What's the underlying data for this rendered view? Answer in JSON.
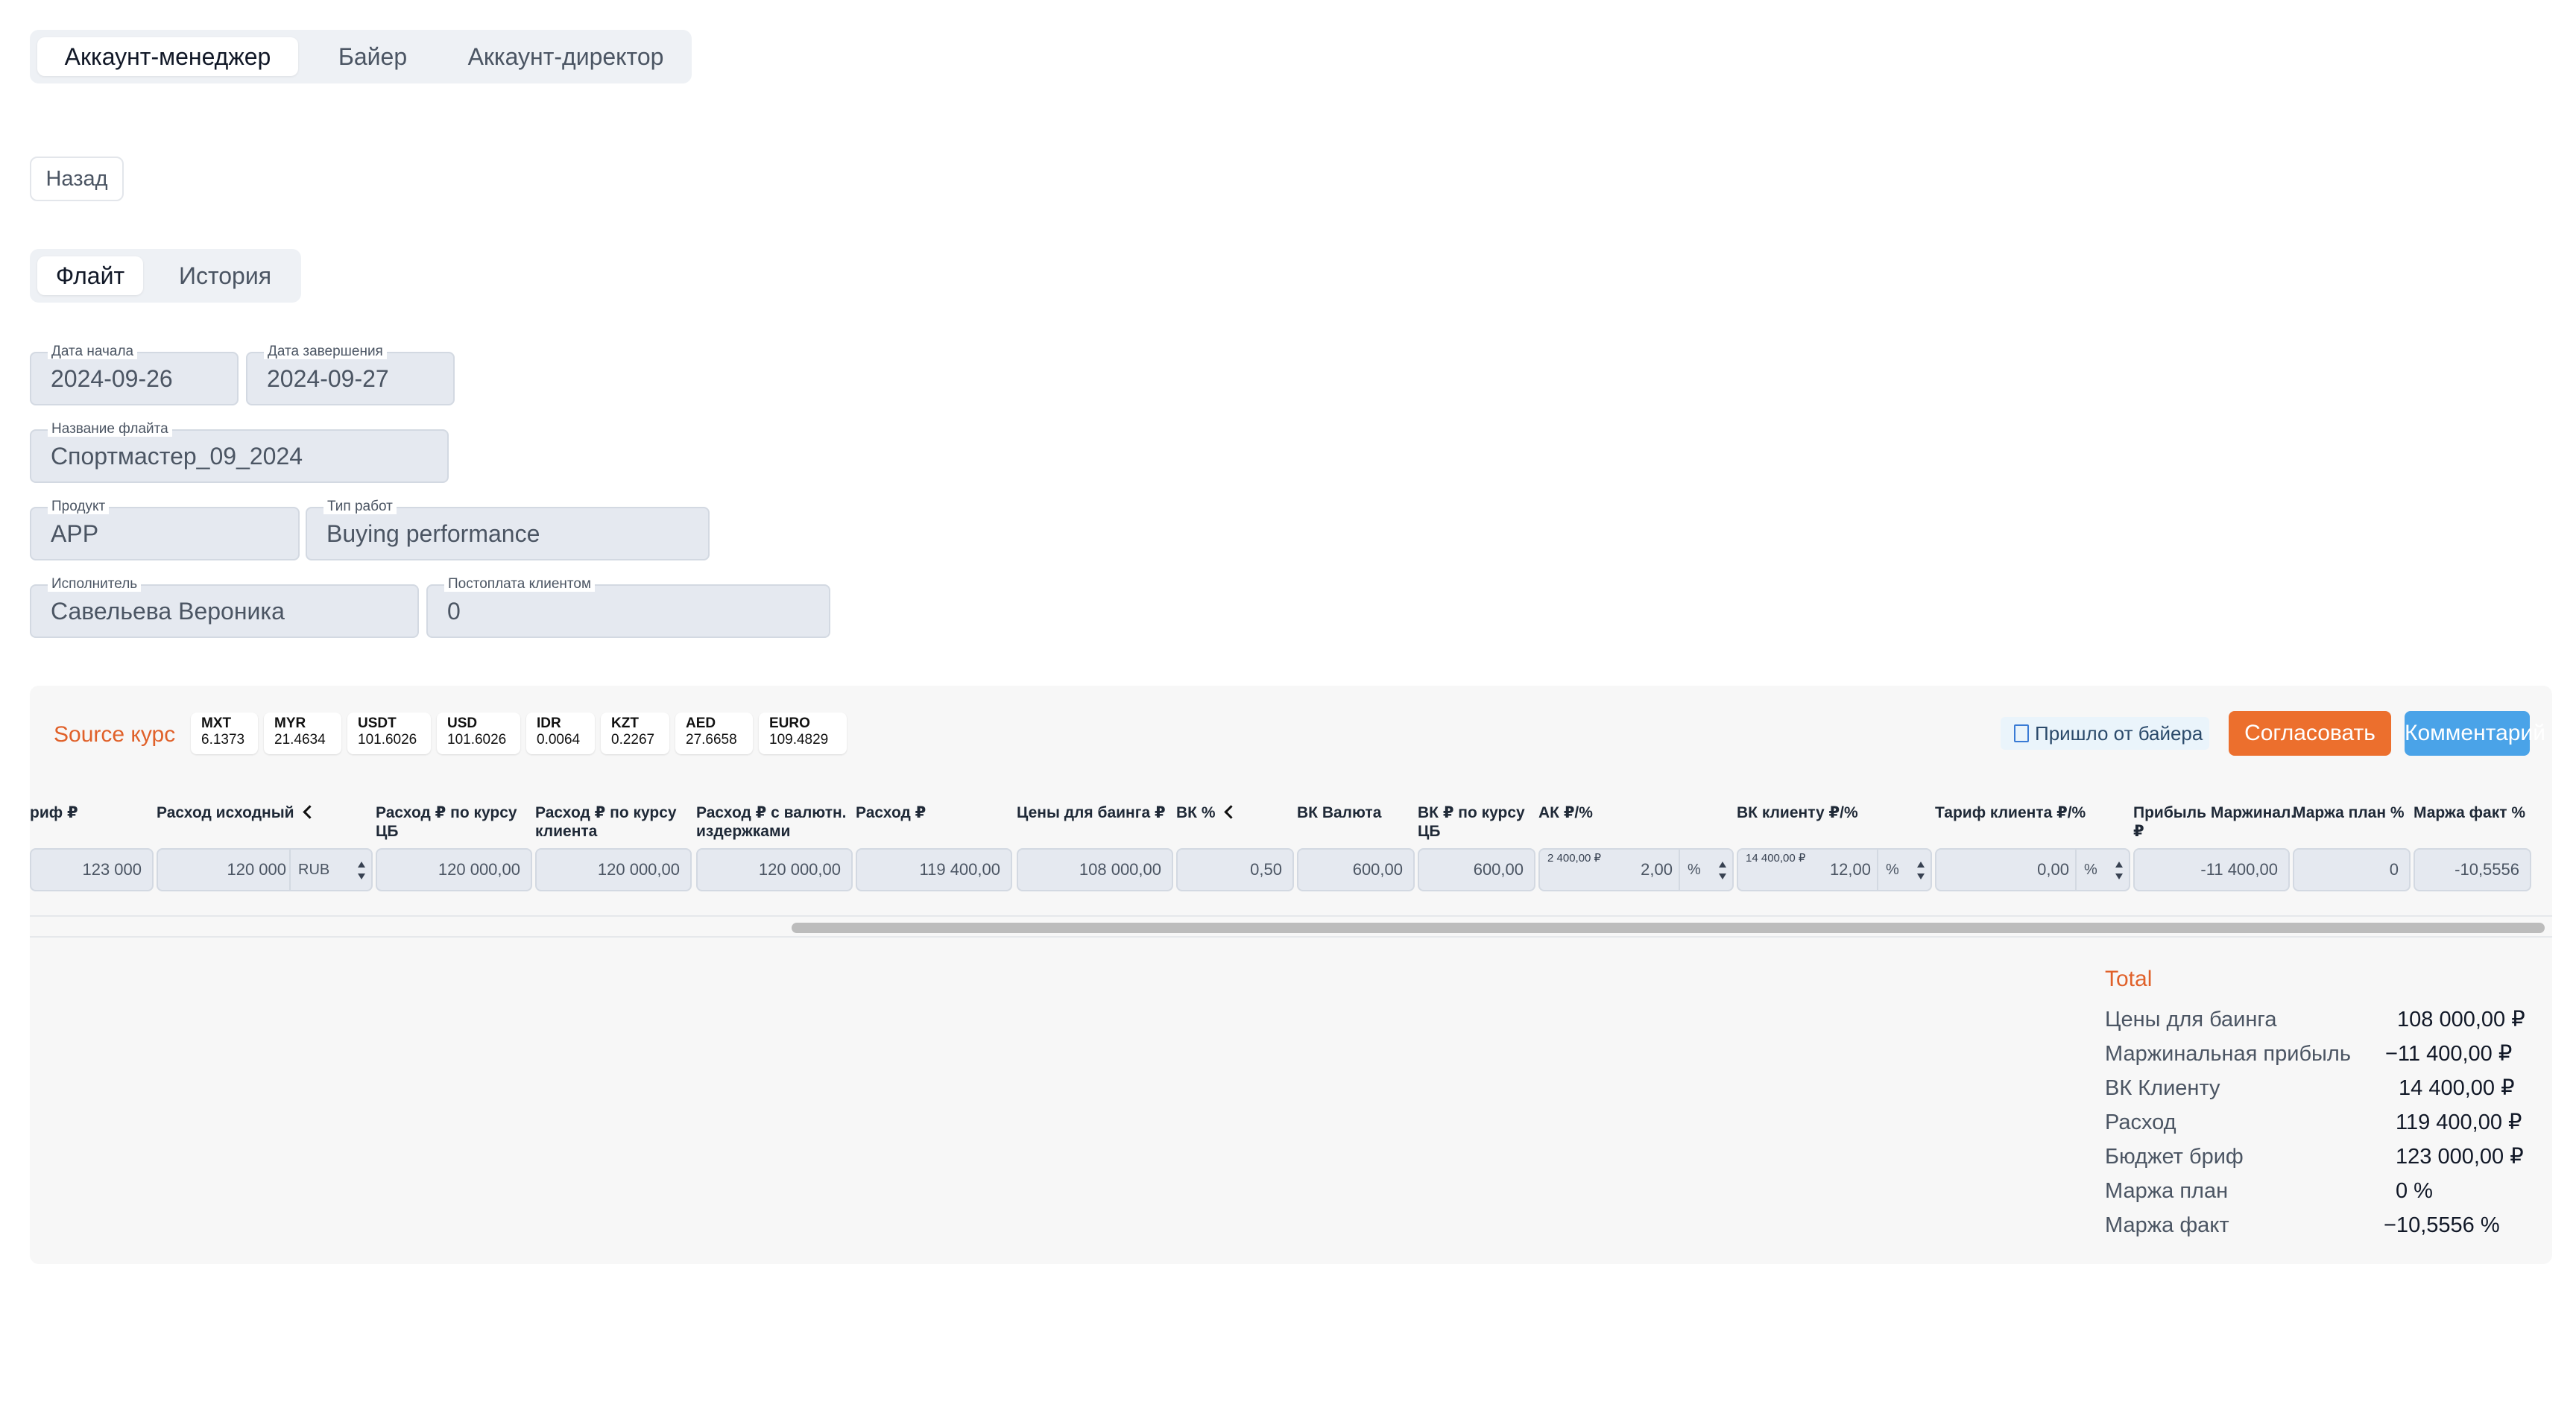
{
  "role_tabs": [
    "Аккаунт-менеджер",
    "Байер",
    "Аккаунт-директор"
  ],
  "back_label": "Назад",
  "flight_tabs": [
    "Флайт",
    "История"
  ],
  "fields": {
    "start_date": {
      "label": "Дата начала",
      "value": "2024-09-26"
    },
    "end_date": {
      "label": "Дата завершения",
      "value": "2024-09-27"
    },
    "flight_name": {
      "label": "Название флайта",
      "value": "Спортмастер_09_2024"
    },
    "product": {
      "label": "Продукт",
      "value": "APP"
    },
    "work_type": {
      "label": "Тип работ",
      "value": "Buying performance"
    },
    "executor": {
      "label": "Исполнитель",
      "value": "Савельева Вероника"
    },
    "postpay": {
      "label": "Постоплата клиентом",
      "value": "0"
    }
  },
  "source_rate_label": "Source курс",
  "rates": [
    {
      "name": "MXT",
      "value": "6.1373"
    },
    {
      "name": "MYR",
      "value": "21.4634"
    },
    {
      "name": "USDT",
      "value": "101.6026"
    },
    {
      "name": "USD",
      "value": "101.6026"
    },
    {
      "name": "IDR",
      "value": "0.0064"
    },
    {
      "name": "KZT",
      "value": "0.2267"
    },
    {
      "name": "AED",
      "value": "27.6658"
    },
    {
      "name": "EURO",
      "value": "109.4829"
    }
  ],
  "actions": {
    "from_buyer": "Пришло от байера",
    "approve": "Согласовать",
    "comment": "Комментарий"
  },
  "columns": {
    "tariff": "риф ₽",
    "spend_initial": "Расход исходный",
    "spend_cb_l1": "Расход ₽ по курсу",
    "spend_cb_l2": "ЦБ",
    "spend_client_l1": "Расход ₽ по курсу",
    "spend_client_l2": "клиента",
    "spend_fx_l1": "Расход ₽ с валютн.",
    "spend_fx_l2": "издержками",
    "spend": "Расход ₽",
    "buying_price": "Цены для баинга ₽",
    "vk_pct": "ВК %",
    "vk_currency": "ВК Валюта",
    "vk_cb_l1": "ВК ₽ по курсу",
    "vk_cb_l2": "ЦБ",
    "ak": "АК ₽/%",
    "vk_client": "ВК клиенту ₽/%",
    "client_tariff": "Тариф клиента ₽/%",
    "profit_l1": "Прибыль Маржинал.",
    "profit_l2": "₽",
    "margin_plan": "Маржа план %",
    "margin_fact": "Маржа факт %"
  },
  "row": {
    "tariff": "123 000",
    "spend_initial": "120 000",
    "currency": "RUB",
    "spend_cb": "120 000,00",
    "spend_client": "120 000,00",
    "spend_fx": "120 000,00",
    "spend": "119 400,00",
    "buying_price": "108 000,00",
    "vk_pct": "0,50",
    "vk_currency": "600,00",
    "vk_cb": "600,00",
    "ak_small": "2 400,00 ₽",
    "ak": "2,00",
    "ak_unit": "%",
    "vk_client_small": "14 400,00 ₽",
    "vk_client": "12,00",
    "vk_client_unit": "%",
    "client_tariff": "0,00",
    "client_tariff_unit": "%",
    "profit": "-11 400,00",
    "margin_plan": "0",
    "margin_fact": "-10,5556"
  },
  "total": {
    "title": "Total",
    "items": [
      {
        "label": "Цены для баинга",
        "value": "108 000,00 ₽"
      },
      {
        "label": "Маржинальная прибыль",
        "value": "−11 400,00 ₽"
      },
      {
        "label": "ВК Клиенту",
        "value": "14 400,00 ₽"
      },
      {
        "label": "Расход",
        "value": "119 400,00 ₽"
      },
      {
        "label": "Бюджет бриф",
        "value": "123 000,00 ₽"
      },
      {
        "label": "Маржа план",
        "value": "0 %"
      },
      {
        "label": "Маржа факт",
        "value": "−10,5556 %"
      }
    ]
  }
}
